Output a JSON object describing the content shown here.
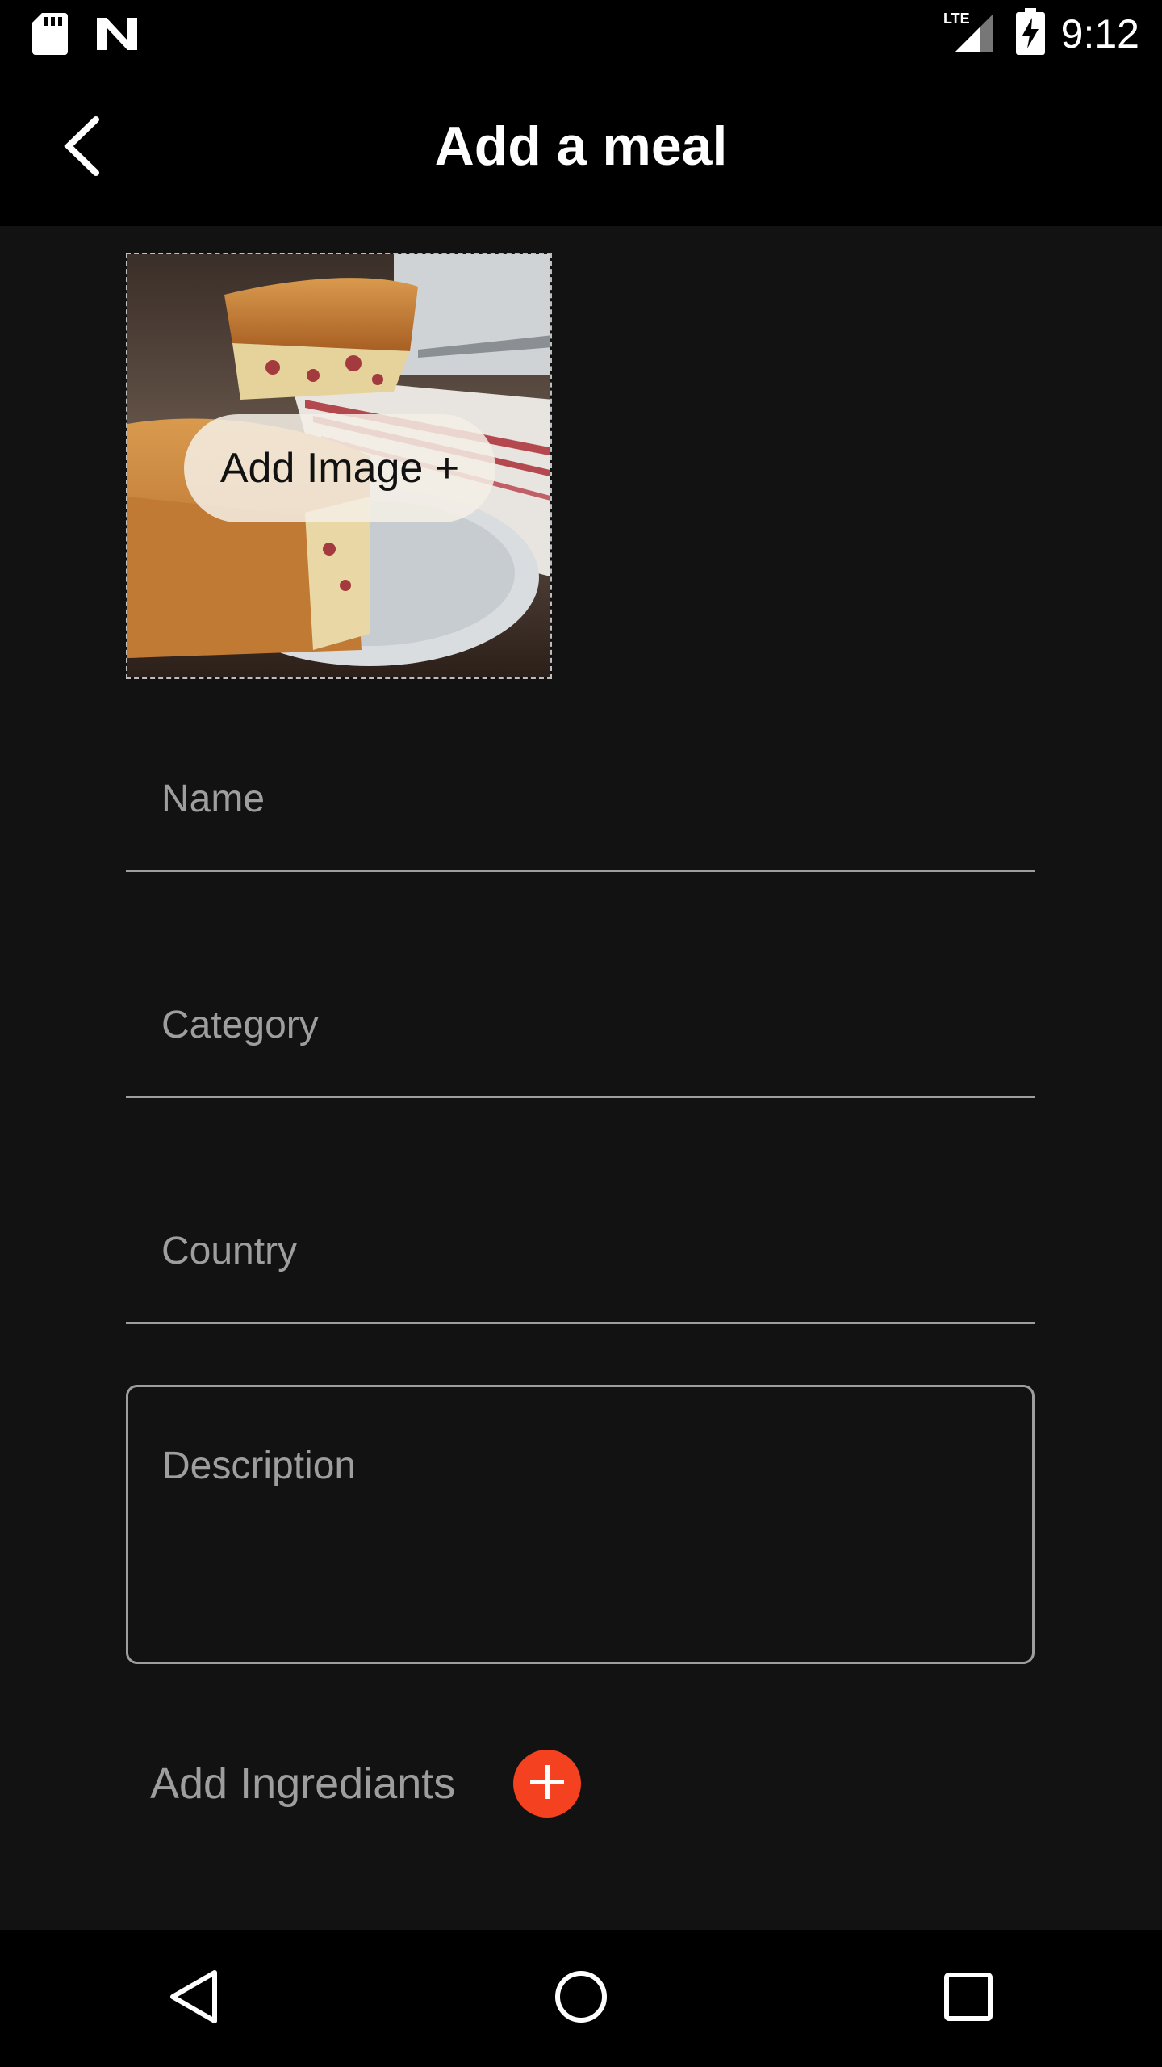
{
  "status_bar": {
    "time": "9:12",
    "network": "LTE",
    "icons": [
      "sd-card-icon",
      "n-notification-icon",
      "lte-signal-icon",
      "battery-charging-icon"
    ]
  },
  "app_bar": {
    "title": "Add a meal",
    "back_icon": "back-arrow-icon"
  },
  "image_picker": {
    "label": "Add Image +"
  },
  "form": {
    "name_placeholder": "Name",
    "category_placeholder": "Category",
    "country_placeholder": "Country",
    "description_placeholder": "Description",
    "ingredients_label": "Add Ingrediants",
    "ingredients_add_icon": "plus-circle-icon"
  },
  "colors": {
    "background": "#121212",
    "bar": "#000000",
    "accent": "#f4411f",
    "hint": "#9e9e9e"
  },
  "nav_bar": {
    "icons": [
      "back-triangle-icon",
      "home-circle-icon",
      "recents-square-icon"
    ]
  }
}
